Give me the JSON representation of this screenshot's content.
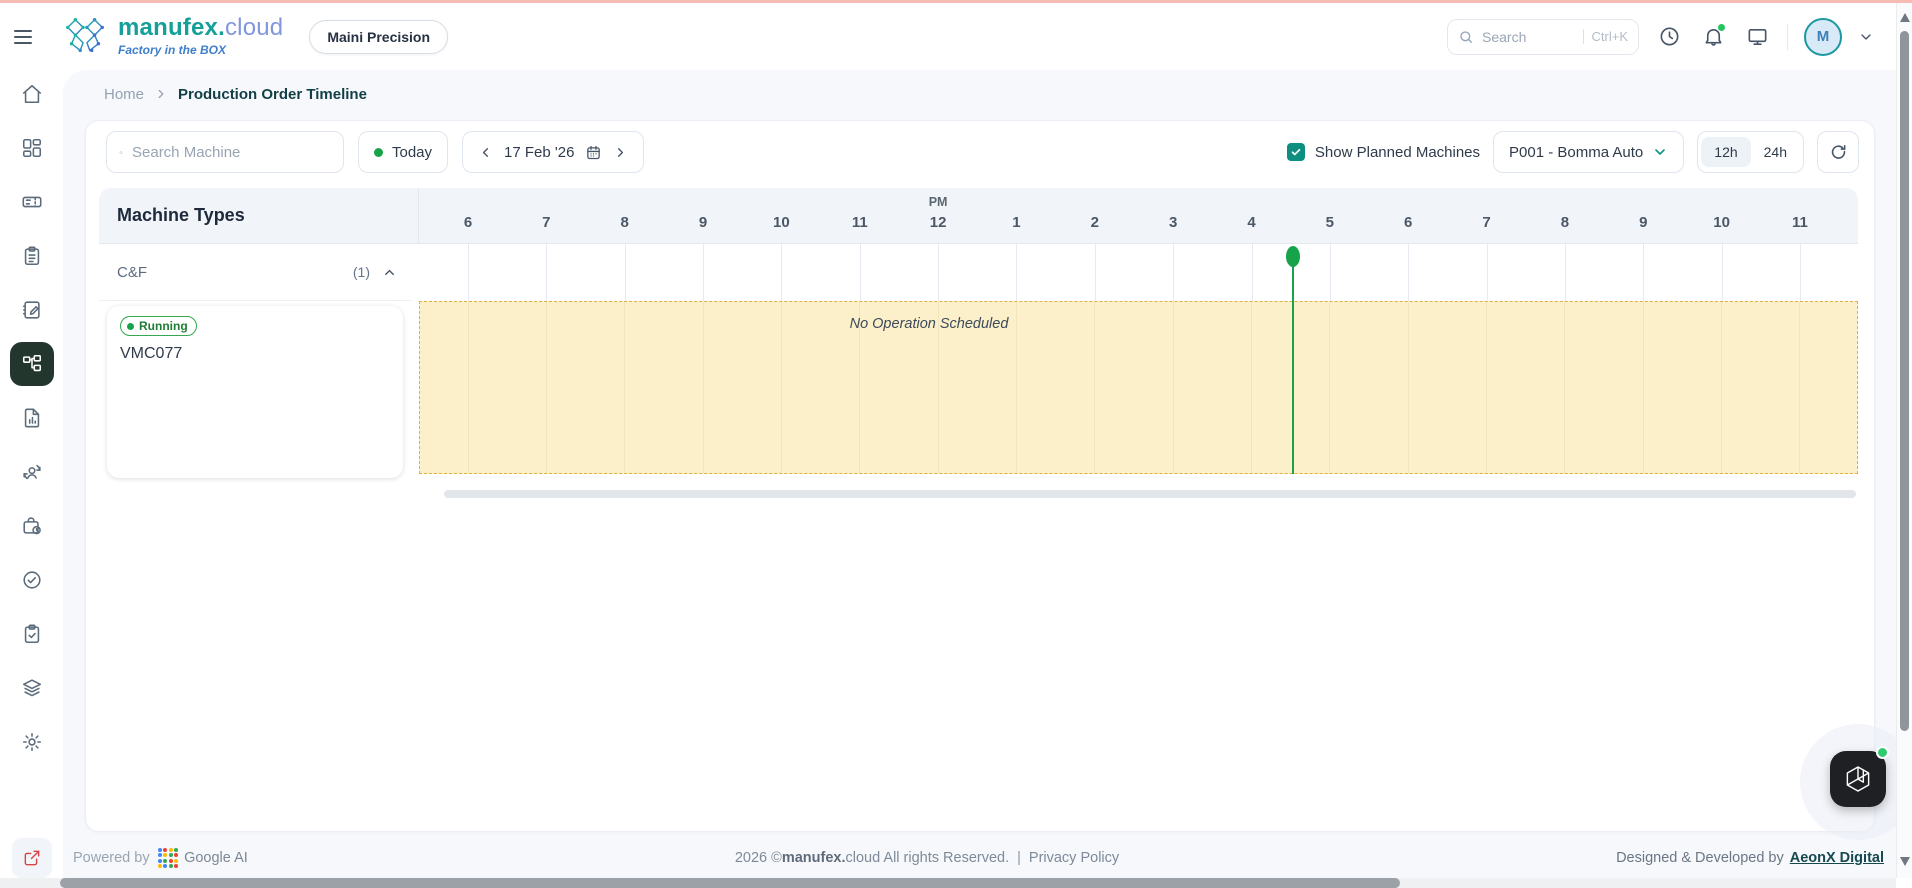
{
  "header": {
    "brand": {
      "name_primary": "manufex.",
      "name_secondary": "cloud",
      "tagline": "Factory in the BOX"
    },
    "tenant_badge": "Maini Precision",
    "search": {
      "placeholder": "Search",
      "shortcut": "Ctrl+K"
    },
    "user": {
      "initial": "M"
    }
  },
  "sidebar": {
    "items": [
      "home",
      "dashboard",
      "ticket",
      "clipboard-list",
      "notebook-pen",
      "workflow",
      "file-chart",
      "user-sync",
      "bag-clock",
      "check-circle",
      "clipboard-check",
      "layers",
      "settings"
    ],
    "active": "workflow",
    "footer_icon": "external-link"
  },
  "breadcrumb": {
    "home": "Home",
    "current": "Production Order Timeline"
  },
  "toolbar": {
    "machine_search_placeholder": "Search Machine",
    "today_label": "Today",
    "date_label": "17 Feb '26",
    "show_planned_label": "Show Planned Machines",
    "show_planned_checked": true,
    "plant_selected": "P001 - Bomma Auto",
    "hour_format_options": [
      "12h",
      "24h"
    ],
    "hour_format_selected": "12h"
  },
  "timeline": {
    "panel_title": "Machine Types",
    "meridiem_label": "PM",
    "meridiem_index": 6,
    "hours": [
      "6",
      "7",
      "8",
      "9",
      "10",
      "11",
      "12",
      "1",
      "2",
      "3",
      "4",
      "5",
      "6",
      "7",
      "8",
      "9",
      "10",
      "11"
    ],
    "group": {
      "name": "C&F",
      "count": "(1)"
    },
    "machine": {
      "name": "VMC077",
      "status": "Running"
    },
    "empty_message": "No Operation Scheduled",
    "now_position_pct": 60.7
  },
  "footer": {
    "powered_by": "Powered by",
    "powered_brand": "Google AI",
    "copyright_prefix": "2026 © ",
    "copyright_brand": "manufex.",
    "copyright_suffix": "cloud All rights Reserved. ",
    "separator": "|",
    "privacy": "Privacy Policy",
    "credit_prefix": "Designed & Developed by",
    "credit_brand": "AeonX Digital"
  },
  "colors": {
    "accent_teal": "#0d9488",
    "brand_teal": "#16a099",
    "brand_blue": "#4f74d9",
    "status_green": "#16a34a",
    "empty_slot_bg": "#fbf0c9",
    "empty_slot_border": "#e0b13c",
    "active_nav_bg": "#22362e",
    "top_strip_pink": "#f5bcb4"
  }
}
